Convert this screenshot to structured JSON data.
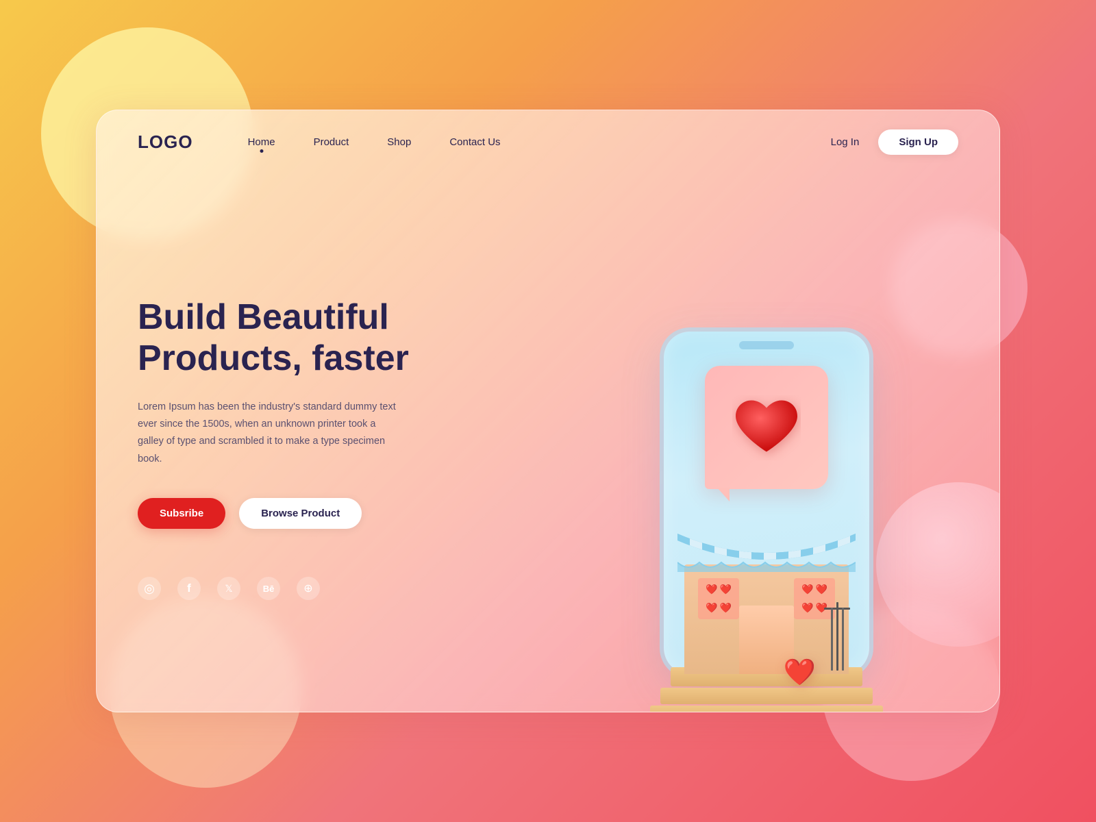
{
  "background": {
    "gradient": "linear-gradient(135deg, #f7c94b 0%, #f5a04a 30%, #f0747a 60%, #f05060 100%)"
  },
  "navbar": {
    "logo": "LOGO",
    "links": [
      {
        "label": "Home",
        "active": true
      },
      {
        "label": "Product",
        "active": false
      },
      {
        "label": "Shop",
        "active": false
      },
      {
        "label": "Contact Us",
        "active": false
      }
    ],
    "login_label": "Log In",
    "signup_label": "Sign Up"
  },
  "hero": {
    "title_line1": "Build Beautiful",
    "title_line2": "Products, faster",
    "description": "Lorem Ipsum has been the industry's standard dummy text ever since the 1500s, when an unknown printer took a galley of type and scrambled it to make a type specimen book.",
    "btn_subscribe": "Subsribe",
    "btn_browse": "Browse Product"
  },
  "social": {
    "icons": [
      {
        "name": "instagram",
        "label": "Instagram"
      },
      {
        "name": "facebook",
        "label": "Facebook"
      },
      {
        "name": "twitter",
        "label": "Twitter"
      },
      {
        "name": "behance",
        "label": "Behance"
      },
      {
        "name": "dribbble",
        "label": "Dribbble"
      }
    ]
  },
  "colors": {
    "primary_red": "#e02020",
    "dark_navy": "#2a2350",
    "white": "#ffffff"
  }
}
